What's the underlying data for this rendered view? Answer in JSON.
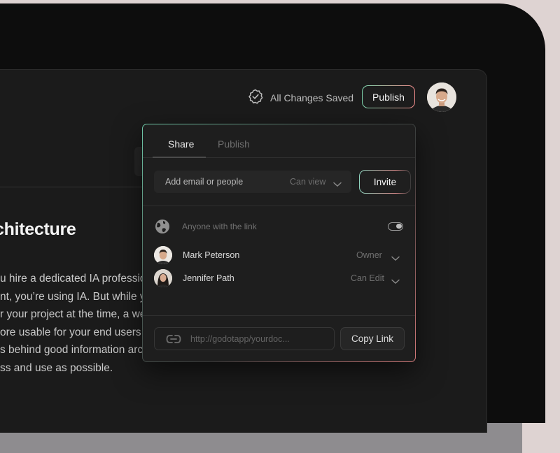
{
  "header": {
    "save_status": "All Changes Saved",
    "publish_label": "Publish"
  },
  "background_doc": {
    "heading": "chitecture",
    "paragraph_lines": [
      "u hire a dedicated IA profession",
      "nt, you’re using IA. But while you",
      "r your project at the time, a well-",
      "ore usable for your end users. W",
      "s behind good information archi",
      "ss and use as possible."
    ]
  },
  "share_panel": {
    "tabs": [
      {
        "label": "Share",
        "active": true
      },
      {
        "label": "Publish",
        "active": false
      }
    ],
    "email_placeholder": "Add email or people",
    "permission": "Can view",
    "invite_label": "Invite",
    "link_access_label": "Anyone with the link",
    "link_access_enabled": true,
    "people": [
      {
        "name": "Mark Peterson",
        "role": "Owner"
      },
      {
        "name": "Jennifer Path",
        "role": "Can Edit"
      }
    ],
    "share_url": "http://godotapp/yourdoc...",
    "copy_label": "Copy Link"
  },
  "colors": {
    "accent_green": "#7fd9b0",
    "accent_red": "#f08a8a",
    "panel_bg": "#1e1e1e"
  },
  "icons": [
    "check-badge-icon",
    "globe-icon",
    "chevron-down-icon",
    "link-icon",
    "toggle-switch"
  ]
}
